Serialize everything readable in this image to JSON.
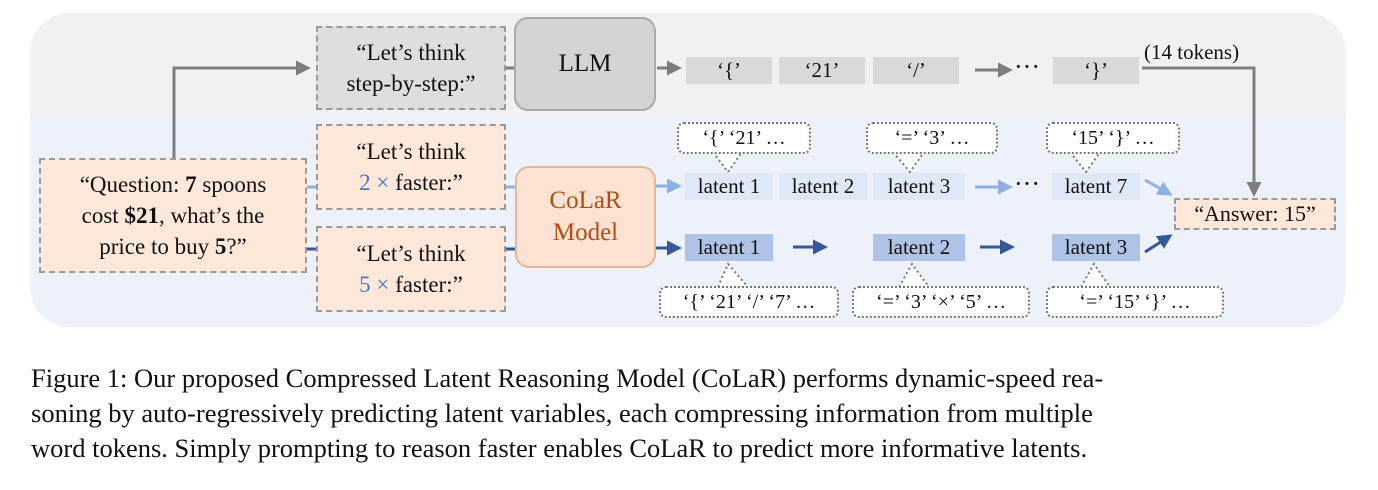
{
  "figure": {
    "llm_label": "LLM",
    "colar_label_line1": "CoLaR",
    "colar_label_line2": "Model",
    "question": {
      "line1_pre": "“Question: ",
      "line1_bold": "7",
      "line1_post": " spoons",
      "line2_pre": "cost ",
      "line2_bold": "$21",
      "line2_post": ", what’s the",
      "line3_pre": "price to buy ",
      "line3_bold": "5",
      "line3_post": "?”"
    },
    "prompt_stepbystep": {
      "line1": "“Let’s think",
      "line2": "step-by-step:”"
    },
    "prompt_2x": {
      "line1": "“Let’s think",
      "line2_num": "2 ×",
      "line2_rest": " faster:”"
    },
    "prompt_5x": {
      "line1": "“Let’s think",
      "line2_num": "5 ×",
      "line2_rest": " faster:”"
    },
    "llm_tokens": [
      "‘{’",
      "‘21’",
      "‘/’",
      "‘}’"
    ],
    "ellipsis": "···",
    "token_count": "(14 tokens)",
    "latents_2x": [
      "latent 1",
      "latent 2",
      "latent 3",
      "latent 7"
    ],
    "latents_5x": [
      "latent 1",
      "latent 2",
      "latent 3"
    ],
    "bubbles_2x": [
      "‘{’ ‘21’ …",
      "‘=’ ‘3’ …",
      "‘15’ ‘}’ …"
    ],
    "bubbles_5x": [
      "‘{’ ‘21’ ‘/’ ‘7’ …",
      "‘=’ ‘3’ ‘×’ ‘5’ …",
      "‘=’ ‘15’ ‘}’ …"
    ],
    "answer": "“Answer: 15”",
    "colors": {
      "upper_band": "#f1f1f1",
      "lower_band": "#edf2fa",
      "arrow_gray": "#7d7d7d",
      "arrow_light_blue": "#8fb0e2",
      "arrow_dark_blue": "#34569a",
      "peach": "#fde8da"
    }
  },
  "caption": {
    "line1": "Figure 1: Our proposed Compressed Latent Reasoning Model (CoLaR) performs dynamic-speed rea-",
    "line2": "soning by auto-regressively predicting latent variables, each compressing information from multiple",
    "line3": "word tokens. Simply prompting to reason faster enables CoLaR to predict more informative latents."
  }
}
